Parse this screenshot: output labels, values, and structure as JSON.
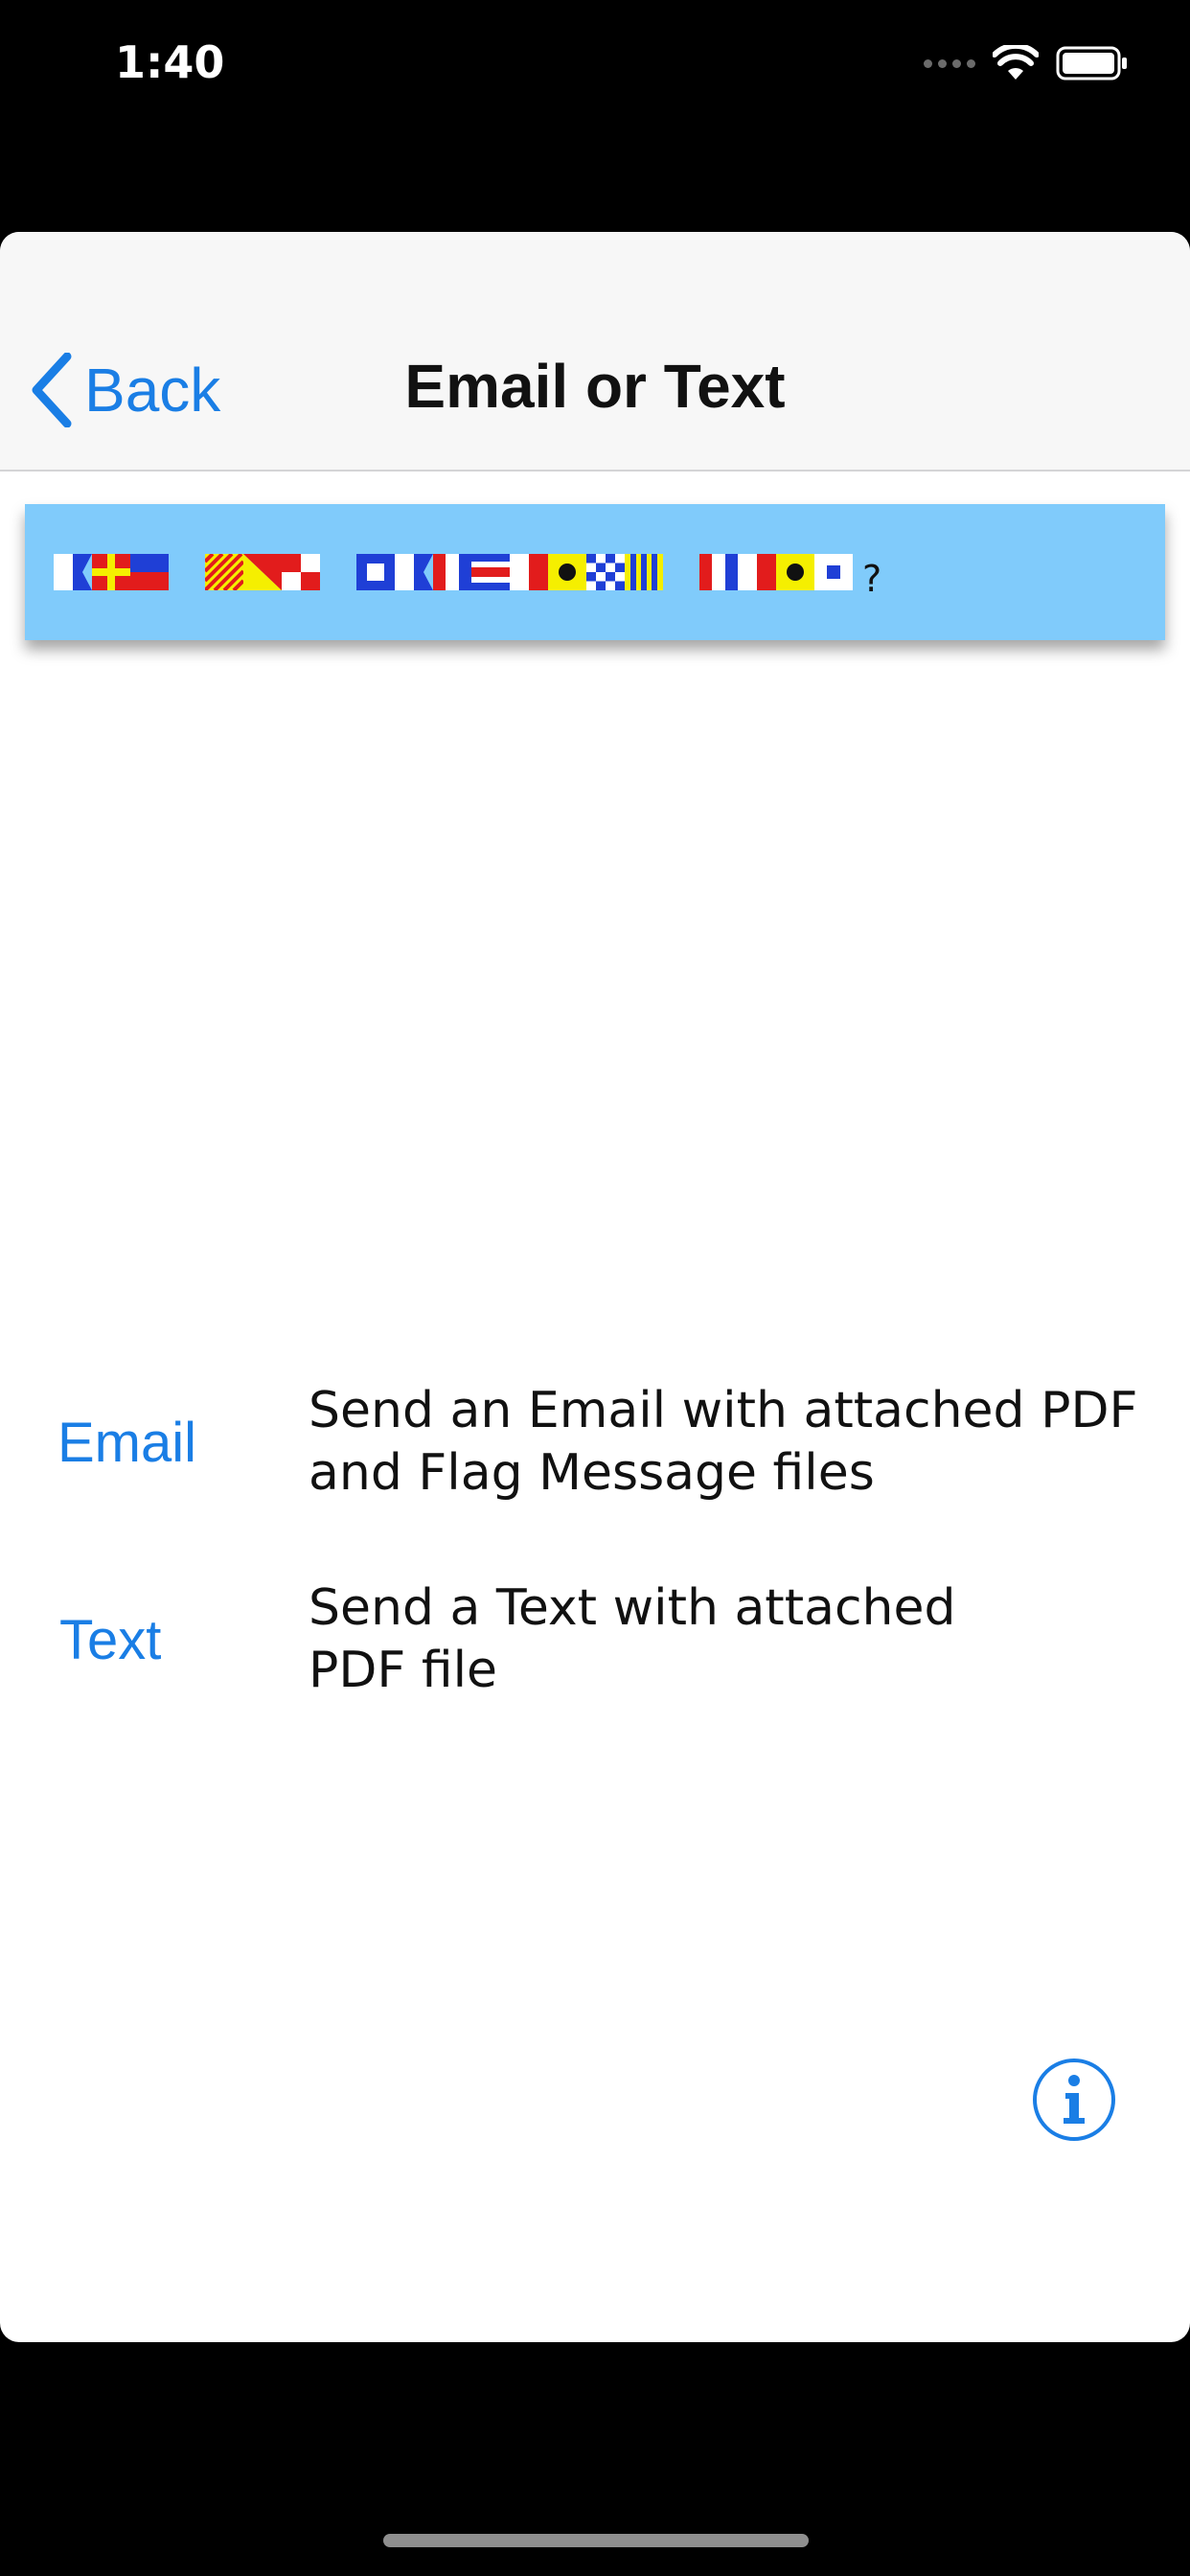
{
  "status_bar": {
    "time": "1:40",
    "icons": [
      "cellular-signal-icon",
      "wifi-icon",
      "battery-icon"
    ]
  },
  "nav": {
    "back_label": "Back",
    "title": "Email or Text"
  },
  "banner": {
    "trailing_text": "?"
  },
  "options": [
    {
      "link": "Email",
      "description_line1": "Send an Email with attached PDF",
      "description_line2": "and Flag Message files"
    },
    {
      "link": "Text",
      "description_line1": "Send a Text with attached",
      "description_line2": "PDF file"
    }
  ],
  "info_icon": "info-circle-icon",
  "colors": {
    "accent": "#1a7ee5",
    "banner": "#80cbfb",
    "navbar": "#f7f7f7"
  }
}
